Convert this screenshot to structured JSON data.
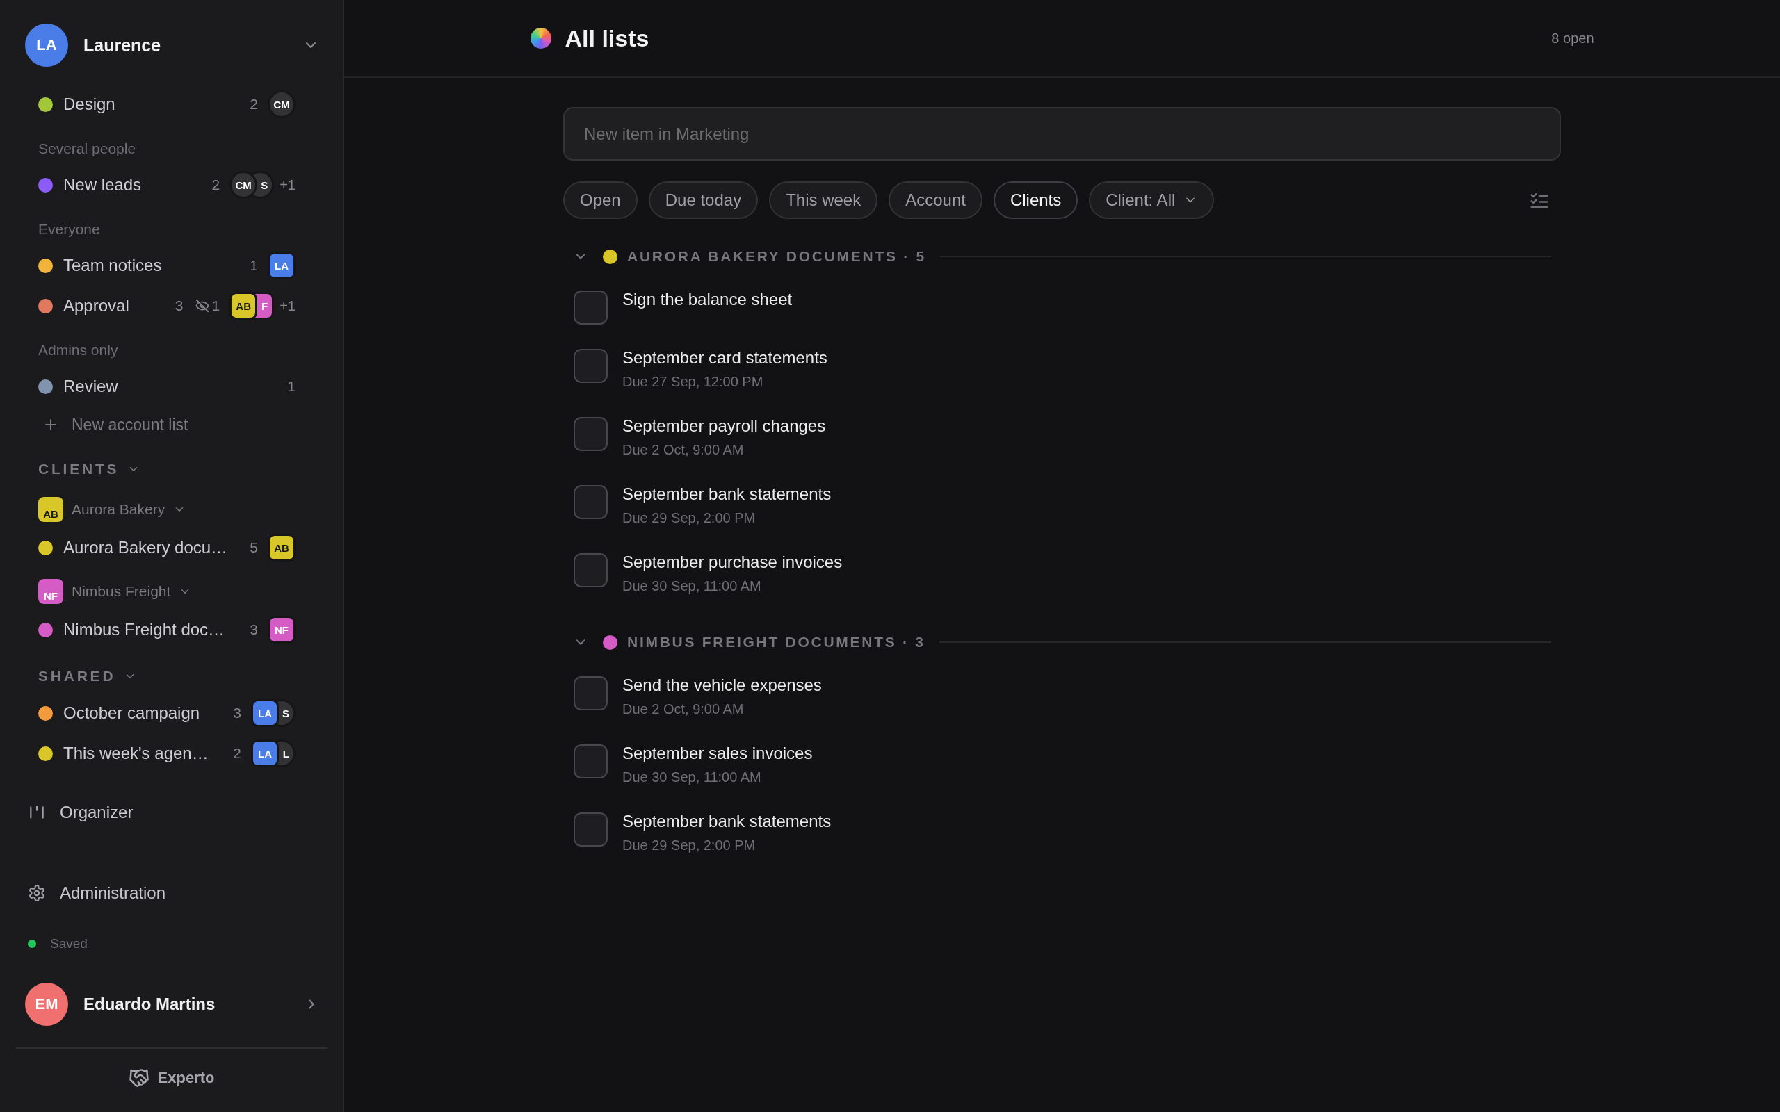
{
  "sidebar": {
    "account": {
      "initials": "LA",
      "name": "Laurence"
    },
    "entries": [
      {
        "kind": "list",
        "name": "Design",
        "color": "#a4c639",
        "count": "2",
        "avatars": [
          {
            "initials": "CM",
            "color": "#333336",
            "kind": "person"
          }
        ]
      },
      {
        "kind": "subheading",
        "label": "Several people"
      },
      {
        "kind": "list",
        "name": "New leads",
        "color": "#8b5cf6",
        "count": "2",
        "avatars": [
          {
            "initials": "CM",
            "color": "#333336",
            "kind": "person"
          },
          {
            "initials": "S",
            "color": "#333336",
            "kind": "person"
          }
        ],
        "more": "+1"
      },
      {
        "kind": "subheading",
        "label": "Everyone"
      },
      {
        "kind": "list",
        "name": "Team notices",
        "color": "#f0b43c",
        "count": "1",
        "avatars": [
          {
            "initials": "LA",
            "color": "#4a7de8",
            "kind": "member"
          }
        ]
      },
      {
        "kind": "list",
        "name": "Approval",
        "color": "#e07a5f",
        "count": "3",
        "hidden": "1",
        "avatars": [
          {
            "initials": "AB",
            "color": "#d9c72a",
            "kind": "member"
          },
          {
            "initials": "F",
            "color": "#d45cc4",
            "kind": "member"
          }
        ],
        "more": "+1"
      },
      {
        "kind": "subheading",
        "label": "Admins only"
      },
      {
        "kind": "list",
        "name": "Review",
        "color": "#8293ad",
        "count": "1"
      },
      {
        "kind": "add",
        "label": "New account list"
      },
      {
        "kind": "section",
        "label": "CLIENTS",
        "expanded": true
      },
      {
        "kind": "client",
        "name": "Aurora Bakery",
        "initials": "AB",
        "color": "#d9c72a",
        "expanded": true
      },
      {
        "kind": "list",
        "name": "Aurora Bakery docu…",
        "color": "#d9c72a",
        "count": "5",
        "avatars": [
          {
            "initials": "AB",
            "color": "#d9c72a",
            "kind": "member"
          }
        ]
      },
      {
        "kind": "client",
        "name": "Nimbus Freight",
        "initials": "NF",
        "color": "#d45cc4",
        "expanded": true
      },
      {
        "kind": "list",
        "name": "Nimbus Freight doc…",
        "color": "#d45cc4",
        "count": "3",
        "avatars": [
          {
            "initials": "NF",
            "color": "#d45cc4",
            "kind": "member"
          }
        ]
      },
      {
        "kind": "section",
        "label": "SHARED",
        "expanded": true
      },
      {
        "kind": "list",
        "name": "October campaign",
        "color": "#f29b3c",
        "count": "3",
        "avatars": [
          {
            "initials": "LA",
            "color": "#4a7de8",
            "kind": "member"
          },
          {
            "initials": "S",
            "color": "#333336",
            "kind": "person"
          }
        ]
      },
      {
        "kind": "list",
        "name": "This week's agen…",
        "color": "#d9c72a",
        "count": "2",
        "avatars": [
          {
            "initials": "LA",
            "color": "#4a7de8",
            "kind": "member"
          },
          {
            "initials": "L",
            "color": "#333336",
            "kind": "person"
          }
        ]
      }
    ],
    "organizer": "Organizer",
    "administration": "Administration",
    "save_status": "Saved",
    "user": {
      "initials": "EM",
      "name": "Eduardo Martins"
    },
    "brand": "Experto"
  },
  "main": {
    "title": "All lists",
    "open_count": "8 open",
    "new_item": {
      "placeholder": "New item in Marketing"
    },
    "filters": [
      {
        "label": "Open",
        "selected": false,
        "kind": "chip"
      },
      {
        "label": "Due today",
        "selected": false,
        "kind": "chip"
      },
      {
        "label": "This week",
        "selected": false,
        "kind": "chip"
      },
      {
        "label": "Account",
        "selected": false,
        "kind": "chip"
      },
      {
        "label": "Clients",
        "selected": true,
        "kind": "chip"
      },
      {
        "label": "Client: All",
        "selected": false,
        "kind": "dropdown"
      }
    ],
    "groups": [
      {
        "title": "AURORA BAKERY DOCUMENTS · 5",
        "color": "#d9c72a",
        "expanded": true,
        "items": [
          {
            "title": "Sign the balance sheet",
            "checked": false
          },
          {
            "title": "September card statements",
            "due": "Due 27 Sep, 12:00 PM",
            "checked": false
          },
          {
            "title": "September payroll changes",
            "due": "Due 2 Oct, 9:00 AM",
            "checked": false
          },
          {
            "title": "September bank statements",
            "due": "Due 29 Sep, 2:00 PM",
            "checked": false
          },
          {
            "title": "September purchase invoices",
            "due": "Due 30 Sep, 11:00 AM",
            "checked": false
          }
        ]
      },
      {
        "title": "NIMBUS FREIGHT DOCUMENTS · 3",
        "color": "#d45cc4",
        "expanded": true,
        "items": [
          {
            "title": "Send the vehicle expenses",
            "due": "Due 2 Oct, 9:00 AM",
            "checked": false
          },
          {
            "title": "September sales invoices",
            "due": "Due 30 Sep, 11:00 AM",
            "checked": false
          },
          {
            "title": "September bank statements",
            "due": "Due 29 Sep, 2:00 PM",
            "checked": false
          }
        ]
      }
    ]
  }
}
